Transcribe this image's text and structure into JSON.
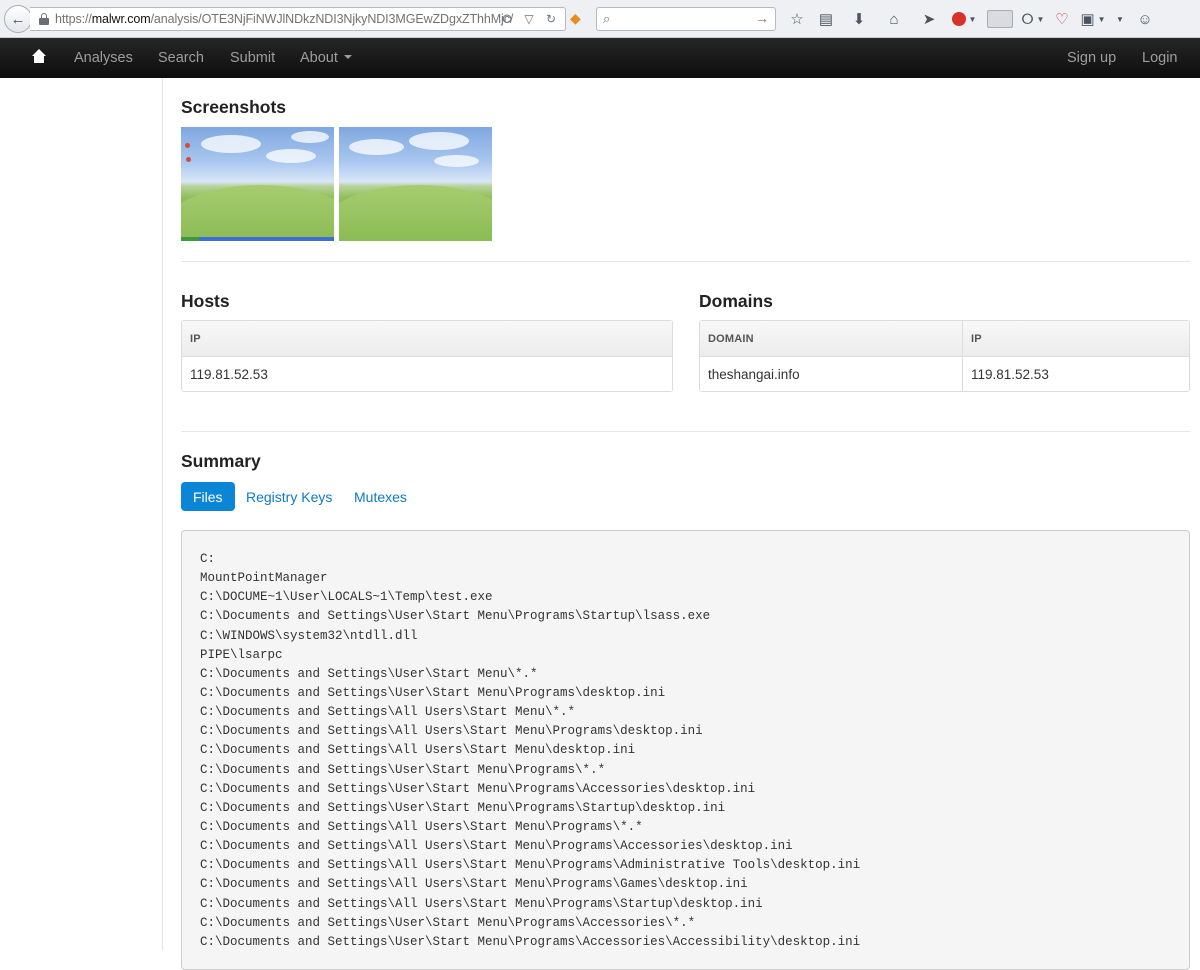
{
  "browser": {
    "url_prefix": "https://",
    "url_host": "malwr.com",
    "url_path": "/analysis/OTE3NjFiNWJlNDkzNDI3NjkyNDI3MGEwZDgxZThhMjc/"
  },
  "nav": {
    "items": [
      "Analyses",
      "Search",
      "Submit",
      "About"
    ],
    "signup": "Sign up",
    "login": "Login"
  },
  "screenshots": {
    "title": "Screenshots"
  },
  "hosts": {
    "title": "Hosts",
    "header": "IP",
    "rows": [
      "119.81.52.53"
    ]
  },
  "domains": {
    "title": "Domains",
    "headers": [
      "DOMAIN",
      "IP"
    ],
    "rows": [
      [
        "theshangai.info",
        "119.81.52.53"
      ]
    ]
  },
  "summary": {
    "title": "Summary",
    "tabs": [
      "Files",
      "Registry Keys",
      "Mutexes"
    ],
    "files": [
      "C:",
      "MountPointManager",
      "C:\\DOCUME~1\\User\\LOCALS~1\\Temp\\test.exe",
      "C:\\Documents and Settings\\User\\Start Menu\\Programs\\Startup\\lsass.exe",
      "C:\\WINDOWS\\system32\\ntdll.dll",
      "PIPE\\lsarpc",
      "C:\\Documents and Settings\\User\\Start Menu\\*.*",
      "C:\\Documents and Settings\\User\\Start Menu\\Programs\\desktop.ini",
      "C:\\Documents and Settings\\All Users\\Start Menu\\*.*",
      "C:\\Documents and Settings\\All Users\\Start Menu\\Programs\\desktop.ini",
      "C:\\Documents and Settings\\All Users\\Start Menu\\desktop.ini",
      "C:\\Documents and Settings\\User\\Start Menu\\Programs\\*.*",
      "C:\\Documents and Settings\\User\\Start Menu\\Programs\\Accessories\\desktop.ini",
      "C:\\Documents and Settings\\User\\Start Menu\\Programs\\Startup\\desktop.ini",
      "C:\\Documents and Settings\\All Users\\Start Menu\\Programs\\*.*",
      "C:\\Documents and Settings\\All Users\\Start Menu\\Programs\\Accessories\\desktop.ini",
      "C:\\Documents and Settings\\All Users\\Start Menu\\Programs\\Administrative Tools\\desktop.ini",
      "C:\\Documents and Settings\\All Users\\Start Menu\\Programs\\Games\\desktop.ini",
      "C:\\Documents and Settings\\All Users\\Start Menu\\Programs\\Startup\\desktop.ini",
      "C:\\Documents and Settings\\User\\Start Menu\\Programs\\Accessories\\*.*",
      "C:\\Documents and Settings\\User\\Start Menu\\Programs\\Accessories\\Accessibility\\desktop.ini"
    ]
  }
}
